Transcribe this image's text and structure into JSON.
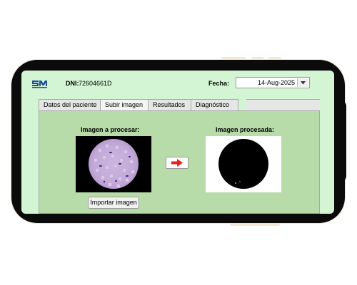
{
  "header": {
    "logo_text": "SM",
    "dni_label": "DNI:",
    "dni_value": "72604661D",
    "fecha_label": "Fecha:",
    "fecha_value": "14-Aug-2025"
  },
  "tabs": [
    {
      "label": "Datos del paciente",
      "active": false
    },
    {
      "label": "Subir imagen",
      "active": true
    },
    {
      "label": "Resultados",
      "active": false
    },
    {
      "label": "Diagnóstico",
      "active": false
    }
  ],
  "panel": {
    "input_label": "Imagen a procesar:",
    "output_label": "Imagen procesada:",
    "import_button": "Importar imagen"
  },
  "colors": {
    "screen_bg": "#d4f5d4",
    "panel_bg": "#b7dca9",
    "arrow": "#e82020",
    "logo": "#1f4f9a"
  },
  "icons": {
    "process_arrow": "right-arrow-icon",
    "date_dropdown": "chevron-down-icon"
  }
}
